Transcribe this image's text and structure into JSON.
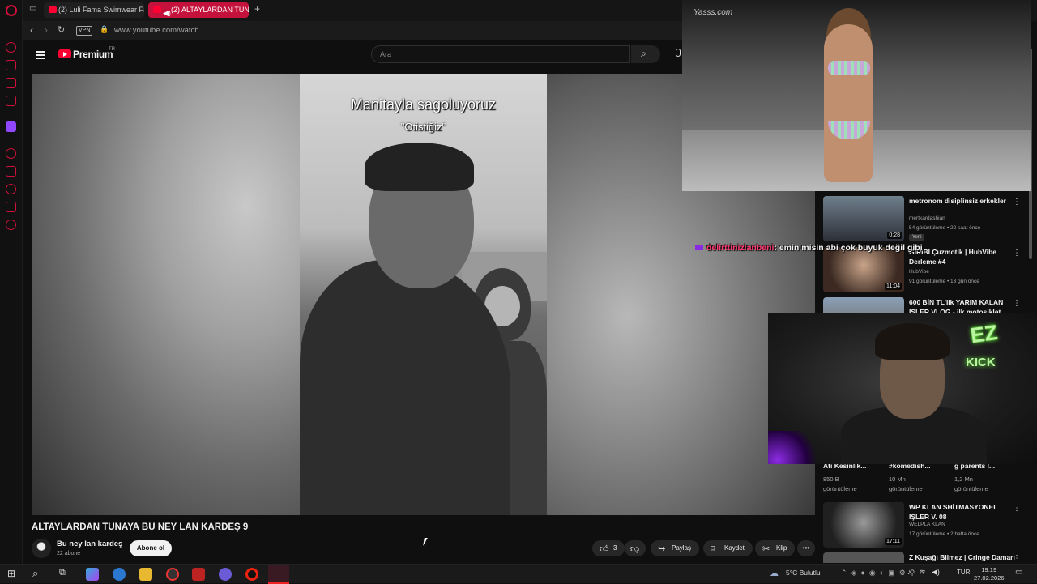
{
  "browser": {
    "tabs": [
      {
        "label": "(2) Luli Fama Swimwear Fa",
        "active": false
      },
      {
        "label": "(2) ALTAYLARDAN TUN",
        "active": true
      }
    ],
    "new_tab": "+",
    "vpn_label": "VPN",
    "url": "www.youtube.com/watch"
  },
  "youtube": {
    "logo_text": "Premium",
    "region": "TR",
    "search_placeholder": "Ara"
  },
  "video": {
    "caption": "Manitayla sagoluyoruz",
    "subcaption": "\"Otistiğiz\"",
    "title": "ALTAYLARDAN TUNAYA BU NEY LAN KARDEŞ 9",
    "channel": "Bu ney lan kardeş",
    "subscribers": "22 abone",
    "subscribe_label": "Abone ol",
    "like_count": "3",
    "share_label": "Paylaş",
    "save_label": "Kaydet",
    "clip_label": "Klip",
    "more": "•••"
  },
  "recommendations": [
    {
      "title": "metronom disiplinsiz erkekler",
      "channel": "mertkardashian",
      "meta": "54 görüntüleme • 22 saat önce",
      "duration": "0:28",
      "badge": "Yeni"
    },
    {
      "title": "GİRİBİ Çuzmotik | HubVibe Derleme #4",
      "channel": "HubVibe",
      "meta": "91 görüntüleme • 13 gün önce",
      "duration": "11:04"
    },
    {
      "title": "600 BİN TL'lik YARIM KALAN İŞLER VLOG - ilk motosiklet",
      "channel": "",
      "meta": "",
      "duration": ""
    },
    {
      "title": "WP KLAN SHİTMASYONEL İŞLER V. 08",
      "channel": "WELPLA KLAN",
      "meta": "17 görüntüleme • 2 hafta önce",
      "duration": "17:11"
    },
    {
      "title": "Z Kuşağı Bilmez | Cringe Damarı",
      "channel": "",
      "meta": "",
      "duration": ""
    }
  ],
  "shorts": [
    {
      "title": "Atı Kesinlik...",
      "views": "850 B",
      "unit": "görüntüleme"
    },
    {
      "title": "#komedish...",
      "views": "10 Mn",
      "unit": "görüntüleme"
    },
    {
      "title": "g parents l...",
      "views": "1,2 Mn",
      "unit": "görüntüleme"
    }
  ],
  "stream": {
    "chat_user": "delirttinizlanbeni",
    "chat_message": ": emin misin abi çok büyük değil gibi",
    "logo_text": "EZ",
    "kick_text": "KICK",
    "watermark": "Yasss.com"
  },
  "taskbar": {
    "weather": "5°C  Bulutlu",
    "language": "TUR",
    "time": "19:19",
    "date": "27.02.2026"
  },
  "colors": {
    "accent": "#ff0033",
    "opera_red": "#d0103a",
    "kick_green": "#6cff3a"
  }
}
